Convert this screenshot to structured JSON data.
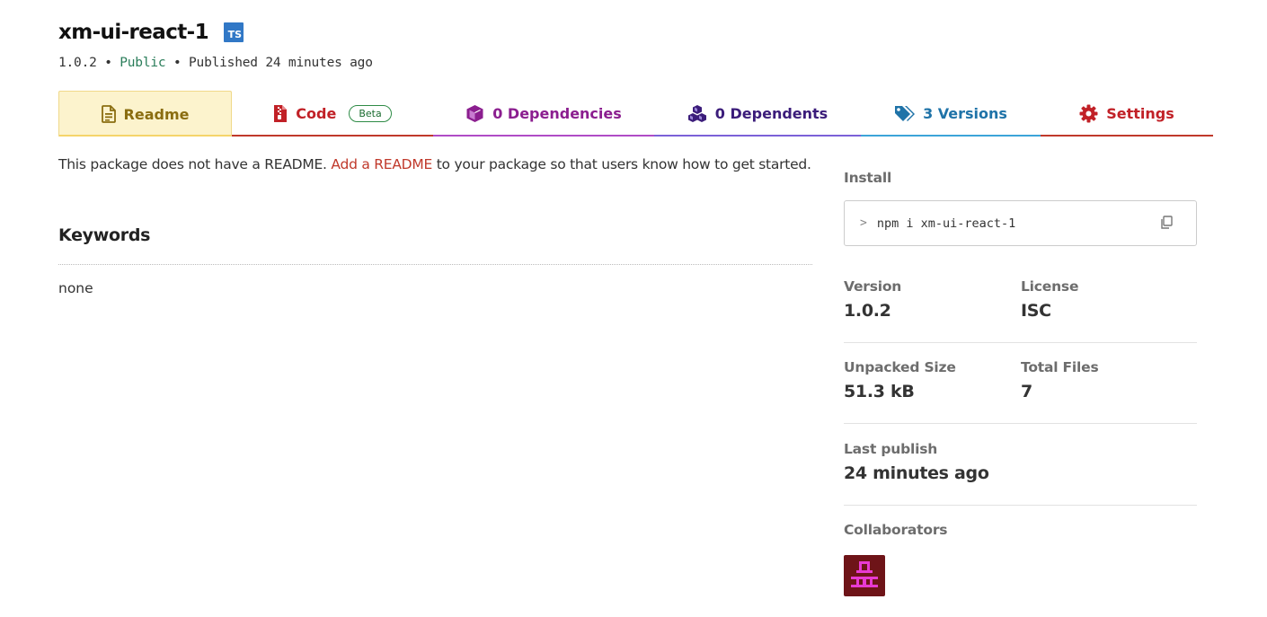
{
  "package": {
    "name": "xm-ui-react-1",
    "ts_badge": "TS",
    "version": "1.0.2",
    "visibility": "Public",
    "published": "Published 24 minutes ago",
    "separator": "•"
  },
  "tabs": [
    {
      "label": "Readme",
      "icon": "readme-doc-icon",
      "color": "#8a6d10"
    },
    {
      "label": "Code",
      "badge": "Beta",
      "icon": "code-file-icon",
      "color": "#c12127"
    },
    {
      "label": "0 Dependencies",
      "icon": "cube-icon",
      "color": "#8b1e8f"
    },
    {
      "label": "0 Dependents",
      "icon": "cubes-icon",
      "color": "#3b1c7a"
    },
    {
      "label": "3 Versions",
      "icon": "tags-icon",
      "color": "#1f73a8"
    },
    {
      "label": "Settings",
      "icon": "gear-icon",
      "color": "#c12127"
    }
  ],
  "readme": {
    "prefix": "This package does not have a README.",
    "link": "Add a README",
    "suffix": "to your package so that users know how to get started."
  },
  "keywords": {
    "title": "Keywords",
    "value": "none"
  },
  "sidebar": {
    "install_label": "Install",
    "install_prompt": ">",
    "install_command": "npm i xm-ui-react-1",
    "version_label": "Version",
    "version_value": "1.0.2",
    "license_label": "License",
    "license_value": "ISC",
    "unpacked_label": "Unpacked Size",
    "unpacked_value": "51.3 kB",
    "files_label": "Total Files",
    "files_value": "7",
    "last_publish_label": "Last publish",
    "last_publish_value": "24 minutes ago",
    "collaborators_label": "Collaborators"
  },
  "colors": {
    "link": "#c0392b",
    "public": "#2a7d5a",
    "ts": "#3178c6",
    "avatar_bg": "#6e1418",
    "avatar_fg": "#e83ad2"
  }
}
